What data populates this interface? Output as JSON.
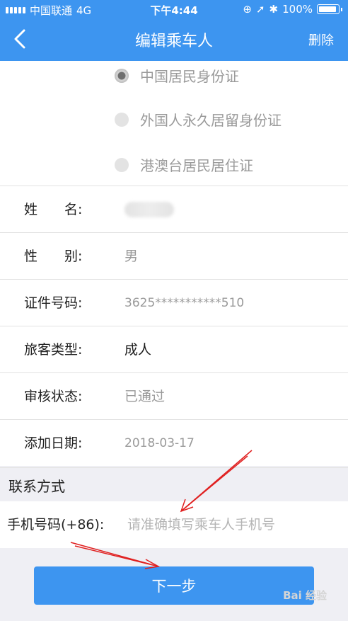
{
  "status_bar": {
    "carrier": "中国联通",
    "network": "4G",
    "time": "下午4:44",
    "battery": "100%"
  },
  "nav": {
    "back_icon": "chevron-left-icon",
    "title": "编辑乘车人",
    "delete_label": "删除"
  },
  "id_types": [
    {
      "label": "中国居民身份证",
      "selected": true
    },
    {
      "label": "外国人永久居留身份证",
      "selected": false
    },
    {
      "label": "港澳台居民居住证",
      "selected": false
    }
  ],
  "fields": {
    "name": {
      "label": "姓　　名:",
      "value": ""
    },
    "gender": {
      "label": "性　　别:",
      "value": "男"
    },
    "id_number": {
      "label": "证件号码:",
      "value": "3625***********510"
    },
    "passenger_type": {
      "label": "旅客类型:",
      "value": "成人"
    },
    "review_status": {
      "label": "审核状态:",
      "value": "已通过"
    },
    "add_date": {
      "label": "添加日期:",
      "value": "2018-03-17"
    }
  },
  "contact": {
    "section_title": "联系方式",
    "phone_label": "手机号码(+86):",
    "phone_placeholder": "请准确填写乘车人手机号",
    "phone_value": ""
  },
  "next_button": "下一步",
  "watermark": "Bai 经验",
  "colors": {
    "brand_blue": "#3d95f0",
    "annotation_red": "#e02020"
  }
}
